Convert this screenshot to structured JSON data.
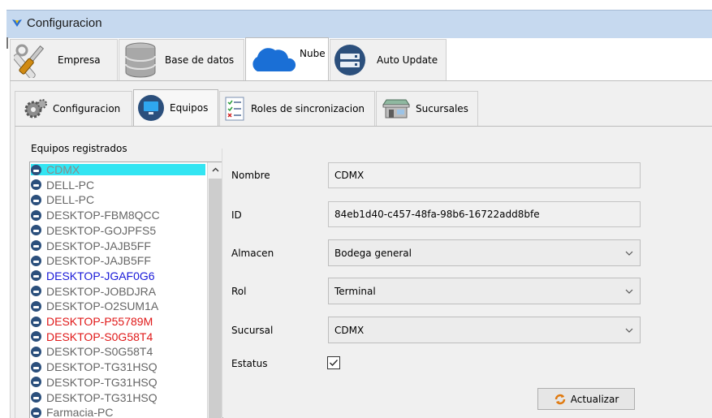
{
  "window": {
    "title": "Configuracion"
  },
  "main_tabs": [
    {
      "label": "Empresa",
      "icon": "tools-icon"
    },
    {
      "label": "Base de datos",
      "icon": "database-icon"
    },
    {
      "label": "Nube",
      "icon": "cloud-icon",
      "active": true
    },
    {
      "label": "Auto Update",
      "icon": "server-icon"
    }
  ],
  "sub_tabs": [
    {
      "label": "Configuracion",
      "icon": "gears-icon"
    },
    {
      "label": "Equipos",
      "icon": "monitor-icon",
      "active": true
    },
    {
      "label": "Roles de sincronizacion",
      "icon": "checklist-icon"
    },
    {
      "label": "Sucursales",
      "icon": "store-icon"
    }
  ],
  "equipos": {
    "label": "Equipos registrados",
    "items": [
      {
        "name": "CDMX",
        "state": "selected"
      },
      {
        "name": "DELL-PC",
        "state": "normal"
      },
      {
        "name": "DELL-PC",
        "state": "normal"
      },
      {
        "name": "DESKTOP-FBM8QCC",
        "state": "normal"
      },
      {
        "name": "DESKTOP-GOJPFS5",
        "state": "normal"
      },
      {
        "name": "DESKTOP-JAJB5FF",
        "state": "normal"
      },
      {
        "name": "DESKTOP-JAJB5FF",
        "state": "normal"
      },
      {
        "name": "DESKTOP-JGAF0G6",
        "state": "blue"
      },
      {
        "name": "DESKTOP-JOBDJRA",
        "state": "normal"
      },
      {
        "name": "DESKTOP-O2SUM1A",
        "state": "normal"
      },
      {
        "name": "DESKTOP-P55789M",
        "state": "red"
      },
      {
        "name": "DESKTOP-S0G58T4",
        "state": "red"
      },
      {
        "name": "DESKTOP-S0G58T4",
        "state": "normal"
      },
      {
        "name": "DESKTOP-TG31HSQ",
        "state": "normal"
      },
      {
        "name": "DESKTOP-TG31HSQ",
        "state": "normal"
      },
      {
        "name": "DESKTOP-TG31HSQ",
        "state": "normal"
      },
      {
        "name": "Farmacia-PC",
        "state": "normal"
      }
    ]
  },
  "form": {
    "nombre": {
      "label": "Nombre",
      "value": "CDMX"
    },
    "id": {
      "label": "ID",
      "value": "84eb1d40-c457-48fa-98b6-16722add8bfe"
    },
    "almacen": {
      "label": "Almacen",
      "value": "Bodega general"
    },
    "rol": {
      "label": "Rol",
      "value": "Terminal"
    },
    "sucursal": {
      "label": "Sucursal",
      "value": "CDMX"
    },
    "estatus": {
      "label": "Estatus",
      "checked": true
    }
  },
  "actions": {
    "actualizar": "Actualizar"
  },
  "colors": {
    "selected_bg": "#33e5f2",
    "blue_item": "#1818d8",
    "red_item": "#e01818",
    "titlebar": "#c6d9ef"
  }
}
